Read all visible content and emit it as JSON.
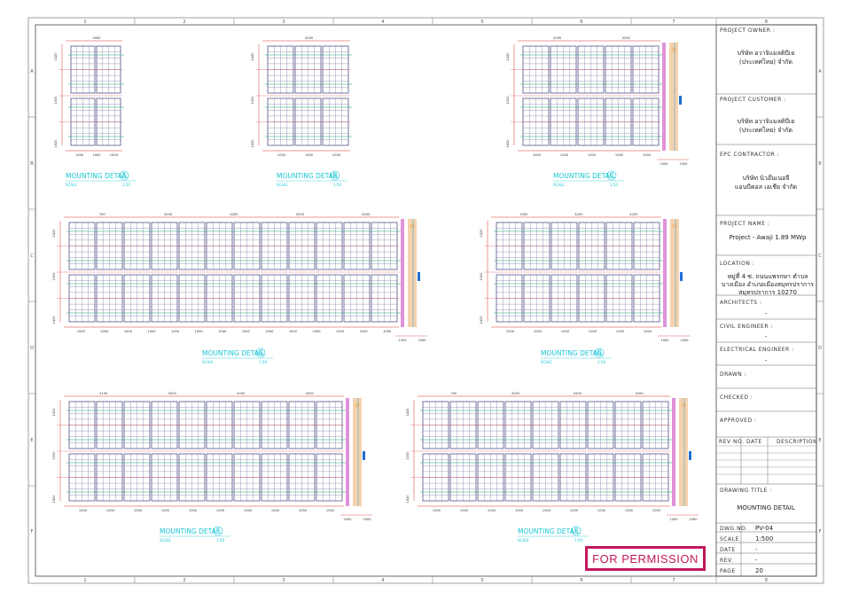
{
  "border": {
    "columns": [
      "1",
      "2",
      "3",
      "4",
      "5",
      "6",
      "7",
      "8"
    ],
    "rows": [
      "A",
      "B",
      "C",
      "D",
      "E",
      "F"
    ]
  },
  "details": [
    {
      "title": "MOUNTING DETAIL",
      "letter": "A",
      "scale_left": "SCALE",
      "scale_right": "1:50",
      "top_dims": [
        "3000"
      ],
      "bottom_dims": [
        "1000",
        "1000",
        "1000"
      ],
      "left_dims": [
        "1420",
        "1000",
        "1420"
      ]
    },
    {
      "title": "MOUNTING DETAIL",
      "letter": "B",
      "scale_left": "SCALE",
      "scale_right": "1:50",
      "top_dims": [
        "4200"
      ],
      "bottom_dims": [
        "1000",
        "1000",
        "1000"
      ],
      "left_dims": [
        "1420",
        "1000",
        "1420"
      ]
    },
    {
      "title": "MOUNTING DETAIL",
      "letter": "C",
      "scale_left": "SCALE",
      "scale_right": "1:50",
      "top_dims": [
        "4200",
        "4200"
      ],
      "bottom_dims": [
        "1000",
        "1000",
        "1000",
        "1000",
        "1000"
      ],
      "left_dims": [
        "1420",
        "1000",
        "1420"
      ],
      "extra_dims": [
        "1000",
        "1000"
      ]
    },
    {
      "title": "MOUNTING DETAIL",
      "letter": "G",
      "scale_left": "SCALE",
      "scale_right": "1:50",
      "top_dims": [
        "700",
        "4200",
        "4200",
        "4200",
        "4200"
      ],
      "bottom_dims": [
        "1000",
        "1000",
        "1000",
        "1000",
        "1000",
        "1000",
        "1000",
        "1000",
        "1000",
        "1000",
        "1000",
        "1000",
        "1000",
        "1000"
      ],
      "left_dims": [
        "1420",
        "1000",
        "1420"
      ],
      "extra_dims": [
        "1000",
        "1000"
      ]
    },
    {
      "title": "MOUNTING DETAIL",
      "letter": "G",
      "scale_left": "SCALE",
      "scale_right": "1:50",
      "top_dims": [
        "1000",
        "4200",
        "4200"
      ],
      "bottom_dims": [
        "1000",
        "1000",
        "1000",
        "1000",
        "1000",
        "1000"
      ],
      "left_dims": [
        "1420",
        "1000",
        "1420"
      ],
      "extra_dims": [
        "1000",
        "1000"
      ]
    },
    {
      "title": "MOUNTING DETAIL",
      "letter": "F",
      "scale_left": "SCALE",
      "scale_right": "1:50",
      "top_dims": [
        "2100",
        "4200",
        "4200",
        "4200"
      ],
      "bottom_dims": [
        "1000",
        "1000",
        "1000",
        "1000",
        "1000",
        "1000",
        "1000",
        "1000",
        "1000",
        "1000"
      ],
      "left_dims": [
        "1420",
        "1000",
        "1420"
      ],
      "extra_dims": [
        "1000",
        "1000"
      ]
    },
    {
      "title": "MOUNTING DETAIL",
      "letter": "E",
      "scale_left": "SCALE",
      "scale_right": "1:50",
      "top_dims": [
        "700",
        "4200",
        "4200",
        "4200"
      ],
      "bottom_dims": [
        "1000",
        "1000",
        "1000",
        "1000",
        "1000",
        "1000",
        "1000",
        "1000",
        "1000"
      ],
      "left_dims": [
        "1420",
        "1000",
        "1420"
      ],
      "extra_dims": [
        "1000",
        "1000"
      ]
    }
  ],
  "title_block": {
    "project_owner_label": "PROJECT OWNER :",
    "project_owner": [
      "บริษัท อวาจิแมลติบีเย",
      "(ประเทศไทย) จำกัด"
    ],
    "project_customer_label": "PROJECT CUSTOMER :",
    "project_customer": [
      "บริษัท อวาจิแมลติบีเย",
      "(ประเทศไทย) จำกัด"
    ],
    "epc_label": "EPC CONTRACTOR :",
    "epc": [
      "บริษัท นิวอ๊นเนอจี",
      "แอนบีคอล เอเชีย จำกัด"
    ],
    "project_name_label": "PROJECT NAME :",
    "project_name": "Project - Awaji 1.89 MWp",
    "location_label": "LOCATION :",
    "location": [
      "หมู่ที่ 4 ซ. ถนนแพรกษา ตำบล",
      "บางเมือง อำเภอเมืองสมุทรปราการ",
      "สมุทรปราการ 10270"
    ],
    "architects_label": "ARCHITECTS :",
    "architects": "-",
    "civil_label": "CIVIL ENGINEER :",
    "civil": "-",
    "electrical_label": "ELECTRICAL ENGINEER :",
    "electrical": "-",
    "drawn_label": "DRAWN :",
    "checked_label": "CHECKED :",
    "approved_label": "APPROVED :",
    "rev_headers": [
      "REV NO.",
      "DATE",
      "DESCRIPTION"
    ],
    "drawing_title_label": "DRAWING TITLE :",
    "drawing_title": "MOUNTING DETAIL",
    "dwg_no_label": "DWG NO.",
    "dwg_no": "PV-04",
    "scale_label": "SCALE",
    "scale": "1:500",
    "date_label": "DATE",
    "date": "-",
    "rev_label": "REV.",
    "rev": "-",
    "page_label": "PAGE",
    "page": "20"
  },
  "stamp": "FOR PERMISSION",
  "colors": {
    "panel": "#3b3b7a",
    "dimension": "#d9342b",
    "rail": "#19a96b",
    "cable": "#d97fd2",
    "walkway": "#f2c79a",
    "detail_title": "#19c6d6",
    "stamp": "#c2185b"
  }
}
